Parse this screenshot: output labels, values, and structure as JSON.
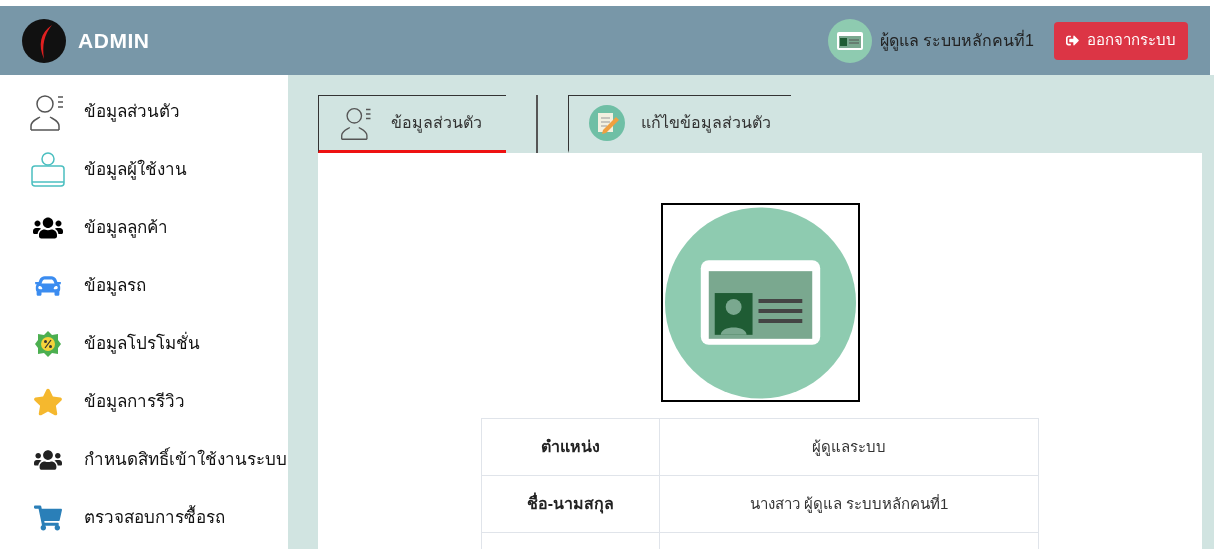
{
  "header": {
    "title": "ADMIN",
    "user": "ผู้ดูแล ระบบหลักคนที่1",
    "logout": "ออกจากระบบ"
  },
  "sidebar": {
    "items": [
      {
        "label": "ข้อมูลส่วนตัว"
      },
      {
        "label": "ข้อมูลผู้ใช้งาน"
      },
      {
        "label": "ข้อมูลลูกค้า"
      },
      {
        "label": "ข้อมูลรถ"
      },
      {
        "label": "ข้อมูลโปรโมชั่น"
      },
      {
        "label": "ข้อมูลการรีวิว"
      },
      {
        "label": "กำหนดสิทธิ์เข้าใช้งานระบบ"
      },
      {
        "label": "ตรวจสอบการซื้อรถ"
      }
    ]
  },
  "tabs": [
    {
      "label": "ข้อมูลส่วนตัว",
      "selected": true
    },
    {
      "label": "แก้ไขข้อมูลส่วนตัว",
      "selected": false
    }
  ],
  "profile": {
    "rows": [
      {
        "label": "ตำแหน่ง",
        "value": "ผู้ดูแลระบบ"
      },
      {
        "label": "ชื่อ-นามสกุล",
        "value": "นางสาว ผู้ดูแล ระบบหลักคนที่1"
      }
    ]
  }
}
